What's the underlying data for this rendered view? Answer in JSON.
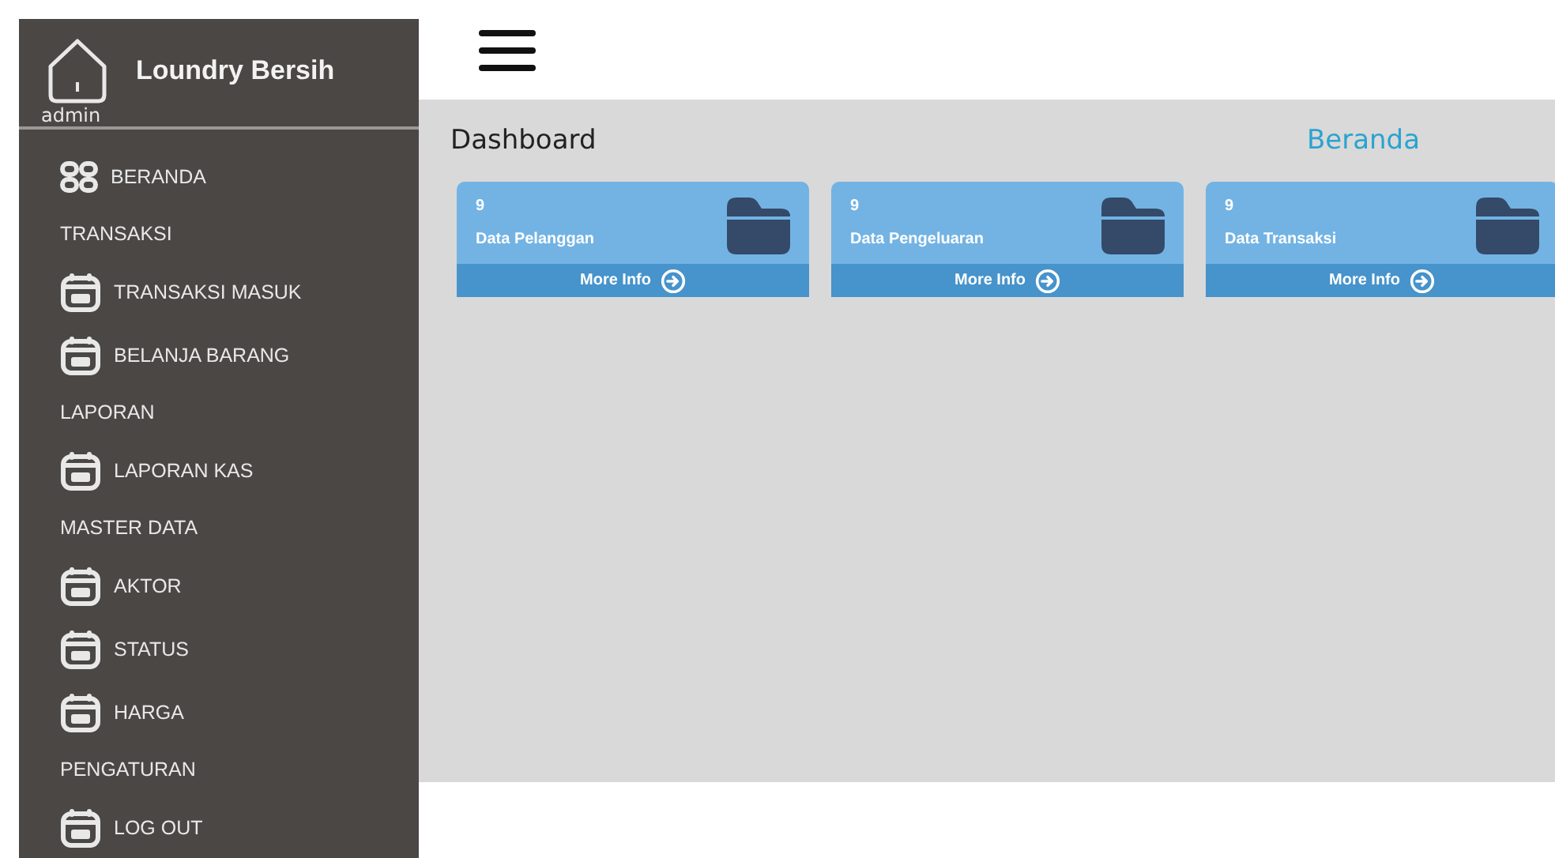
{
  "sidebar": {
    "brand": "Loundry Bersih",
    "user": "admin",
    "items": [
      {
        "kind": "home",
        "label": "BERANDA"
      },
      {
        "kind": "heading",
        "label": "TRANSAKSI"
      },
      {
        "kind": "link",
        "label": "TRANSAKSI MASUK"
      },
      {
        "kind": "link",
        "label": "BELANJA BARANG"
      },
      {
        "kind": "heading",
        "label": "LAPORAN"
      },
      {
        "kind": "link",
        "label": "LAPORAN KAS"
      },
      {
        "kind": "heading",
        "label": "MASTER DATA"
      },
      {
        "kind": "link",
        "label": "AKTOR"
      },
      {
        "kind": "link",
        "label": "STATUS"
      },
      {
        "kind": "link",
        "label": "HARGA"
      },
      {
        "kind": "heading",
        "label": "PENGATURAN"
      },
      {
        "kind": "link",
        "label": "LOG OUT"
      }
    ]
  },
  "page_title": "Dashboard",
  "breadcrumb": "Beranda",
  "cards": [
    {
      "count": "9",
      "label": "Data Pelanggan",
      "link": "More Info"
    },
    {
      "count": "9",
      "label": "Data Pengeluaran",
      "link": "More Info"
    },
    {
      "count": "9",
      "label": "Data Transaksi",
      "link": "More Info"
    }
  ]
}
